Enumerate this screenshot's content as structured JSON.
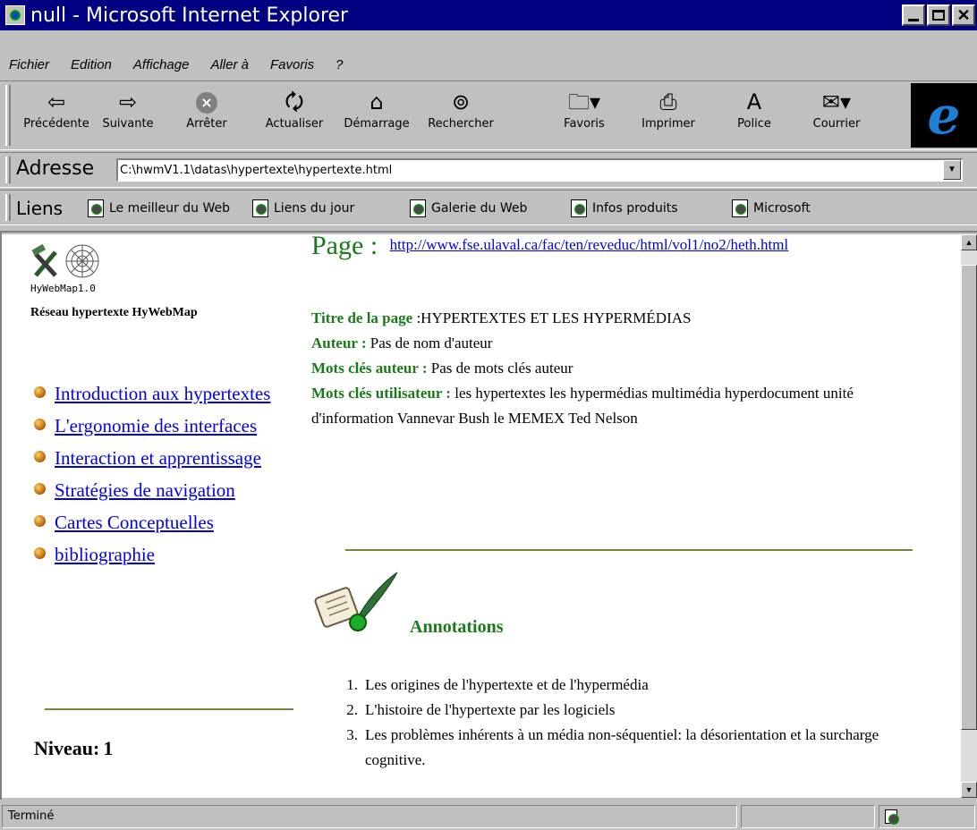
{
  "window": {
    "title": "null - Microsoft Internet Explorer"
  },
  "menu": [
    "Fichier",
    "Edition",
    "Affichage",
    "Aller à",
    "Favoris",
    "?"
  ],
  "toolbar": {
    "back": "Précédente",
    "forward": "Suivante",
    "stop": "Arrêter",
    "refresh": "Actualiser",
    "home": "Démarrage",
    "search": "Rechercher",
    "favorites": "Favoris",
    "print": "Imprimer",
    "font": "Police",
    "mail": "Courrier"
  },
  "address": {
    "label": "Adresse",
    "value": "C:\\hwmV1.1\\datas\\hypertexte\\hypertexte.html"
  },
  "links": {
    "label": "Liens",
    "items": [
      "Le meilleur du Web",
      "Liens du jour",
      "Galerie du Web",
      "Infos produits",
      "Microsoft"
    ]
  },
  "left": {
    "logo_caption": "HyWebMap1.0",
    "network_title": "Réseau hypertexte HyWebMap",
    "nav": [
      "Introduction aux hypertextes",
      "L'ergonomie des interfaces",
      "Interaction et apprentissage",
      "Stratégies de navigation",
      "Cartes Conceptuelles",
      "bibliographie"
    ],
    "level_label": "Niveau:",
    "level_value": "1"
  },
  "right": {
    "page_label": "Page :",
    "page_url": "http://www.fse.ulaval.ca/fac/ten/reveduc/html/vol1/no2/heth.html",
    "title_label": "Titre de la page",
    "title_value": ":HYPERTEXTES ET LES HYPERMÉDIAS",
    "author_label": "Auteur :",
    "author_value": "Pas de nom d'auteur",
    "author_keywords_label": "Mots clés auteur :",
    "author_keywords_value": "Pas de mots clés auteur",
    "user_keywords_label": "Mots clés utilisateur :",
    "user_keywords_value": "les hypertextes  les hypermédias  multimédia  hyperdocument  unité d'information  Vannevar Bush  le MEMEX  Ted Nelson",
    "annotations_title": "Annotations",
    "annotations": [
      "Les origines de l'hypertexte et de l'hypermédia",
      "L'histoire de l'hypertexte par les logiciels",
      "Les problèmes inhérents à un média non-séquentiel: la désorientation et la surcharge cognitive."
    ]
  },
  "status": {
    "text": "Terminé"
  },
  "colors": {
    "titlebar": "#000080",
    "heading_green": "#1a7a1a",
    "link_blue": "#0000ee"
  }
}
